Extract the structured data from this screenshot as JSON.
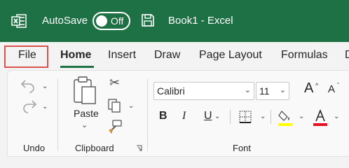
{
  "titlebar": {
    "autosave_label": "AutoSave",
    "autosave_state": "Off",
    "document_title": "Book1  -  Excel"
  },
  "tabs": [
    {
      "label": "File"
    },
    {
      "label": "Home"
    },
    {
      "label": "Insert"
    },
    {
      "label": "Draw"
    },
    {
      "label": "Page Layout"
    },
    {
      "label": "Formulas"
    }
  ],
  "ribbon": {
    "undo_group_label": "Undo",
    "clipboard_group_label": "Clipboard",
    "font_group_label": "Font",
    "paste_label": "Paste",
    "font_name": "Calibri",
    "font_size": "11"
  },
  "colors": {
    "brand": "#1e7145",
    "highlight_color": "#ffff00",
    "font_color": "#e81123",
    "file_tab_outline": "#d9534f"
  }
}
